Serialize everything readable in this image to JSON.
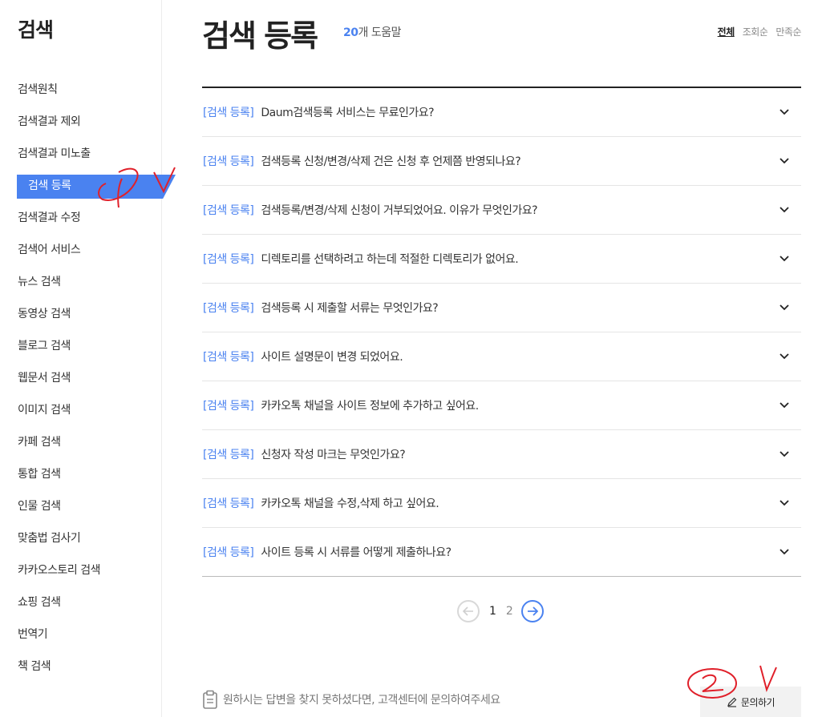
{
  "sidebar": {
    "title": "검색",
    "items": [
      {
        "label": "검색원칙"
      },
      {
        "label": "검색결과 제외"
      },
      {
        "label": "검색결과 미노출"
      },
      {
        "label": "검색 등록",
        "active": true
      },
      {
        "label": "검색결과 수정"
      },
      {
        "label": "검색어 서비스"
      },
      {
        "label": "뉴스 검색"
      },
      {
        "label": "동영상 검색"
      },
      {
        "label": "블로그 검색"
      },
      {
        "label": "웹문서 검색"
      },
      {
        "label": "이미지 검색"
      },
      {
        "label": "카페 검색"
      },
      {
        "label": "통합 검색"
      },
      {
        "label": "인물 검색"
      },
      {
        "label": "맞춤법 검사기"
      },
      {
        "label": "카카오스토리 검색"
      },
      {
        "label": "쇼핑 검색"
      },
      {
        "label": "번역기"
      },
      {
        "label": "책 검색"
      }
    ]
  },
  "header": {
    "title": "검색 등록",
    "count_num": "20",
    "count_label": "개 도움말",
    "sort": {
      "all": "전체",
      "views": "조회순",
      "satisfaction": "만족순"
    }
  },
  "faq": [
    {
      "cat": "[검색 등록]",
      "q": "Daum검색등록 서비스는 무료인가요?"
    },
    {
      "cat": "[검색 등록]",
      "q": "검색등록 신청/변경/삭제 건은 신청 후 언제쯤 반영되나요?"
    },
    {
      "cat": "[검색 등록]",
      "q": "검색등록/변경/삭제 신청이 거부되었어요. 이유가 무엇인가요?"
    },
    {
      "cat": "[검색 등록]",
      "q": "디렉토리를 선택하려고 하는데 적절한 디렉토리가 없어요."
    },
    {
      "cat": "[검색 등록]",
      "q": "검색등록 시 제출할 서류는 무엇인가요?"
    },
    {
      "cat": "[검색 등록]",
      "q": "사이트 설명문이 변경 되었어요."
    },
    {
      "cat": "[검색 등록]",
      "q": "카카오톡 채널을 사이트 정보에 추가하고 싶어요."
    },
    {
      "cat": "[검색 등록]",
      "q": "신청자 작성 마크는 무엇인가요?"
    },
    {
      "cat": "[검색 등록]",
      "q": "카카오톡 채널을 수정,삭제 하고 싶어요."
    },
    {
      "cat": "[검색 등록]",
      "q": "사이트 등록 시 서류를 어떻게 제출하나요?"
    }
  ],
  "pagination": {
    "current": "1",
    "next": "2"
  },
  "footer": {
    "note": "원하시는 답변을 찾지 못하셨다면, 고객센터에 문의하여주세요",
    "inquiry_label": "문의하기"
  },
  "colors": {
    "accent": "#4a82f0",
    "annotation": "#e0202a"
  }
}
